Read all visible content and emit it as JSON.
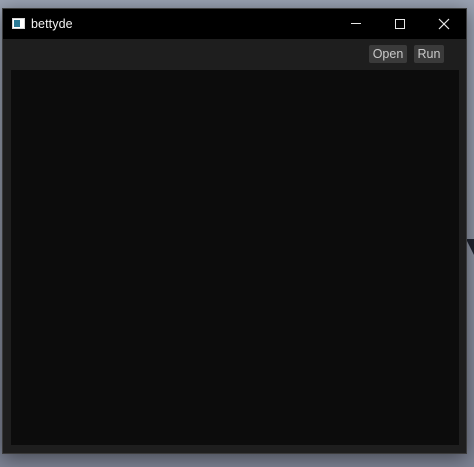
{
  "window": {
    "title": "bettyde",
    "controls": {
      "minimize": "minimize-icon",
      "maximize": "maximize-icon",
      "close": "close-icon"
    }
  },
  "toolbar": {
    "open_label": "Open",
    "run_label": "Run"
  },
  "editor": {
    "content": ""
  },
  "colors": {
    "titlebar": "#000000",
    "window_bg": "#1e1e1e",
    "button_bg": "#3a3a3a",
    "button_text": "#c9c9c9",
    "editor_bg": "#0c0c0c",
    "title_text": "#f2f2f2"
  }
}
